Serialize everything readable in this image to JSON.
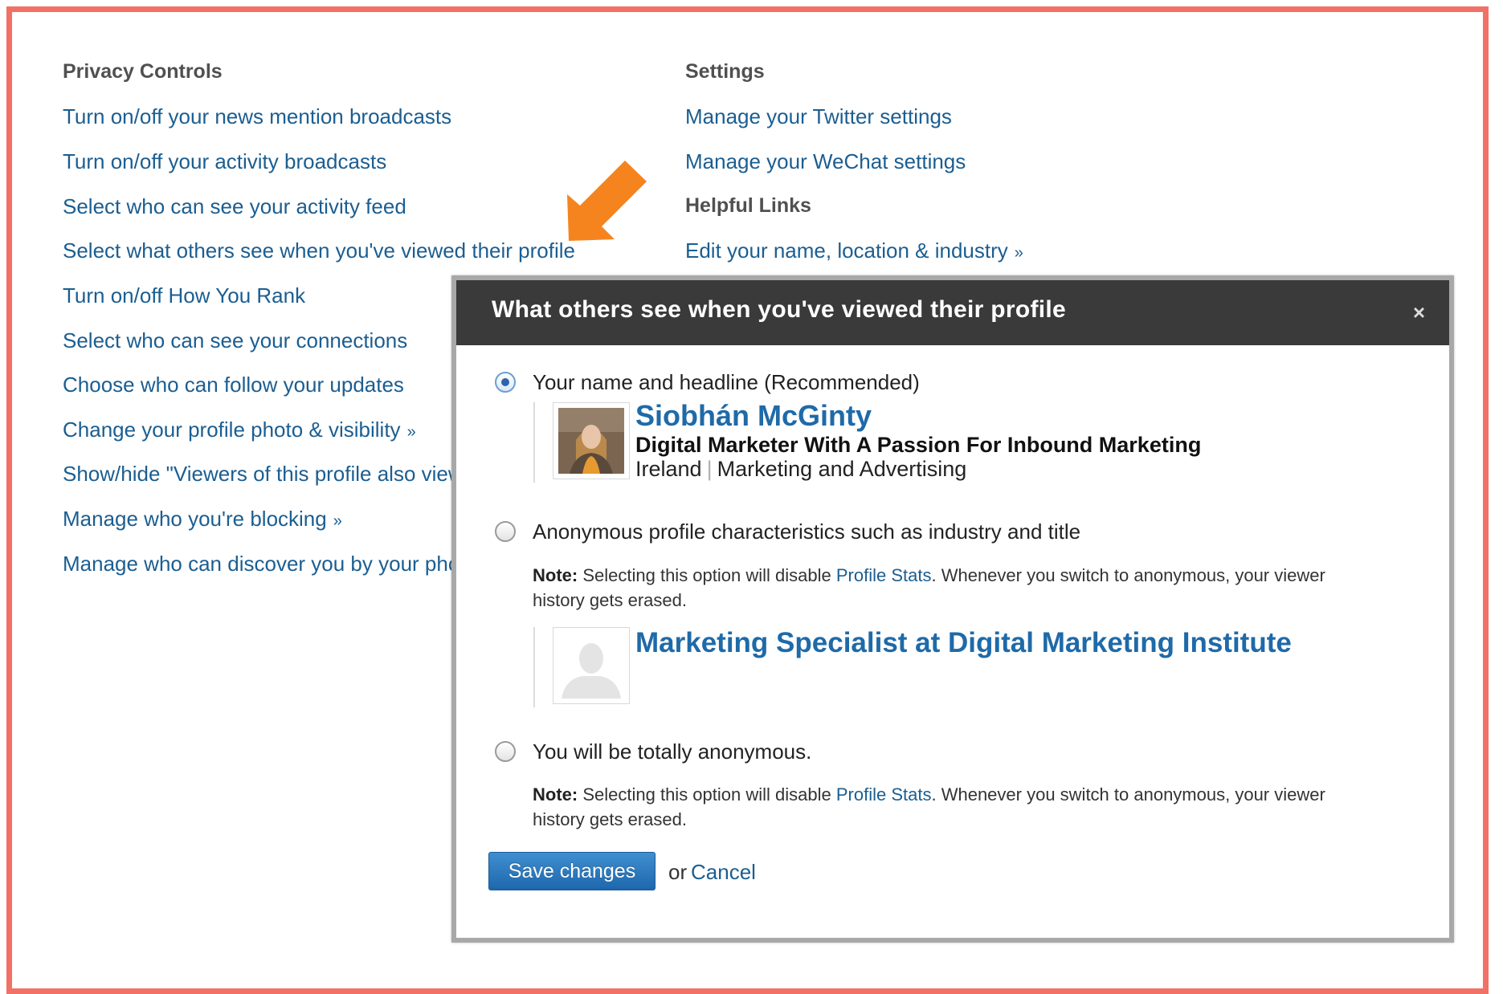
{
  "privacy": {
    "heading": "Privacy Controls",
    "links": [
      "Turn on/off your news mention broadcasts",
      "Turn on/off your activity broadcasts",
      "Select who can see your activity feed",
      "Select what others see when you've viewed their profile",
      "Turn on/off How You Rank",
      "Select who can see your connections",
      "Choose who can follow your updates",
      "Change your profile photo & visibility",
      "Show/hide \"Viewers of this profile also view\"",
      "Manage who you're blocking",
      "Manage who can discover you by your phone number"
    ],
    "more_marker": "»"
  },
  "settings": {
    "heading": "Settings",
    "links": [
      "Manage your Twitter settings",
      "Manage your WeChat settings"
    ]
  },
  "helpful": {
    "heading": "Helpful Links",
    "links": [
      "Edit your name, location & industry"
    ],
    "more_marker": "»"
  },
  "annotation": {
    "arrow_color": "#f5841f",
    "icon": "arrow-down-left-icon"
  },
  "modal": {
    "title": "What others see when you've viewed their profile",
    "close": "×",
    "options": [
      {
        "label": "Your name and headline (Recommended)",
        "selected": true
      },
      {
        "label": "Anonymous profile characteristics such as industry and title",
        "selected": false
      },
      {
        "label": "You will be totally anonymous.",
        "selected": false
      }
    ],
    "profile": {
      "name": "Siobhán McGinty",
      "headline": "Digital Marketer With A Passion For Inbound Marketing",
      "location": "Ireland",
      "separator": "|",
      "industry": "Marketing and Advertising"
    },
    "anonymous_profile": {
      "title": "Marketing Specialist at Digital Marketing Institute"
    },
    "note": {
      "bold": "Note:",
      "before_link": "Selecting this option will disable",
      "link": "Profile Stats",
      "after_link": ". Whenever you switch to anonymous, your viewer history gets erased."
    },
    "buttons": {
      "save": "Save changes",
      "or": "or",
      "cancel": "Cancel"
    }
  },
  "colors": {
    "frame_border": "#f27166",
    "link": "#1b5e91",
    "modal_header": "#3a3a3a",
    "profile_name": "#1f6aa8",
    "button": "#2a77bd"
  }
}
